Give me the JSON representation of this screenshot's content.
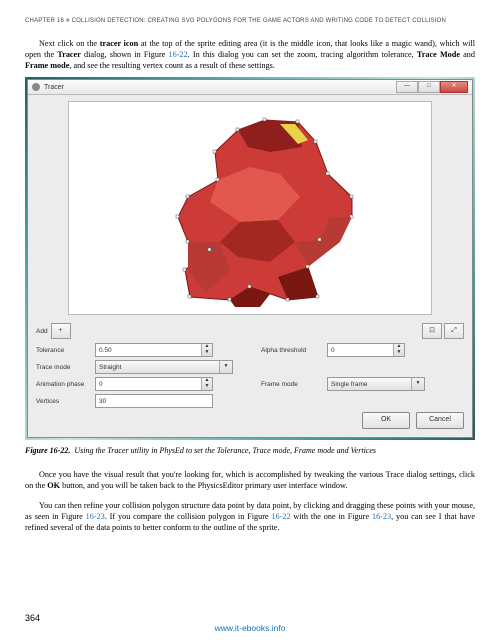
{
  "header": {
    "chapter_label": "CHAPTER 16",
    "separator": "■",
    "chapter_title": "COLLISION DETECTION: CREATING SVG POLYGONS FOR THE GAME ACTORS AND WRITING CODE TO DETECT COLLISION"
  },
  "paragraphs": {
    "p1_a": "Next click on the ",
    "p1_b": "tracer icon",
    "p1_c": " at the top of the sprite editing area (it is the middle icon, that looks like a magic wand), which will open the ",
    "p1_d": "Tracer",
    "p1_e": " dialog, shown in Figure ",
    "p1_link1": "16-22",
    "p1_f": ". In this dialog you can set the zoom, tracing algorithm tolerance, ",
    "p1_g": "Trace Mode",
    "p1_h": " and ",
    "p1_i": "Frame mode",
    "p1_j": ", and see the resulting vertex count as a result of these settings."
  },
  "window": {
    "title": "Tracer",
    "min": "—",
    "max": "□",
    "close": "✕"
  },
  "controls": {
    "add_label": "Add",
    "add_icon": "+",
    "tolerance_label": "Tolerance",
    "tolerance_value": "0.50",
    "alpha_label": "Alpha threshold",
    "alpha_value": "0",
    "tracemode_label": "Trace mode",
    "tracemode_value": "Straight",
    "anim_label": "Animation phase",
    "anim_value": "0",
    "framemode_label": "Frame mode",
    "framemode_value": "Single frame",
    "vertices_label": "Vertices",
    "vertices_value": "30",
    "ok": "OK",
    "cancel": "Cancel",
    "expand": "⤢",
    "fit": "⊡"
  },
  "caption": {
    "fignum": "Figure 16-22.",
    "text": "Using the Tracer utility in PhysEd to set the Tolerance, Trace mode, Frame mode and Vertices"
  },
  "paragraphs2": {
    "p2_a": "Once you have the visual result that you're looking for, which is accomplished by tweaking the various Trace dialog settings, click on the ",
    "p2_b": "OK",
    "p2_c": " button, and you will be taken back to the PhysicsEditor primary user interface window.",
    "p3_a": "You can then refine your collision polygon structure data point by data point, by clicking and dragging these points with your mouse, as seen in Figure ",
    "p3_link1": "16-23",
    "p3_b": ". If you compare the collision polygon in Figure ",
    "p3_link2": "16-22",
    "p3_c": " with the one in Figure ",
    "p3_link3": "16-23",
    "p3_d": ", you can see I that have refined several of the data points to better conform to the outline of the sprite."
  },
  "footer": {
    "pagenum": "364",
    "link": "www.it-ebooks.info"
  }
}
